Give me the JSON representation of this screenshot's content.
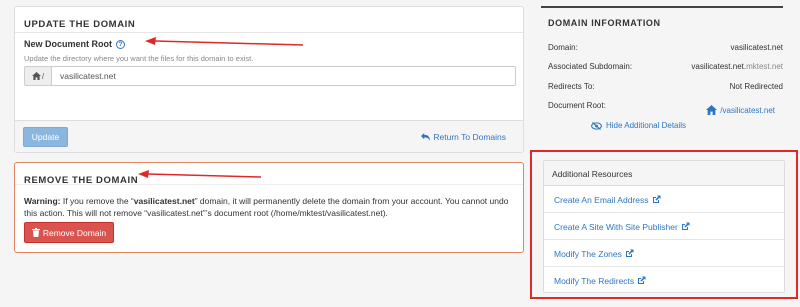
{
  "update_panel": {
    "title": "UPDATE THE DOMAIN",
    "field_label": "New Document Root",
    "field_hint": "Update the directory where you want the files for this domain to exist.",
    "input_addon": "/",
    "input_value": "vasilicatest.net",
    "update_button": "Update",
    "return_link": "Return To Domains"
  },
  "remove_panel": {
    "title": "REMOVE THE DOMAIN",
    "warning_label": "Warning:",
    "warning_pre": " If you remove the “",
    "warning_domain": "vasilicatest.net",
    "warning_post": "” domain, it will permanently delete the domain from your account. You cannot undo this action. This will not remove “vasilicatest.net”’s document root (/home/mktest/vasilicatest.net).",
    "remove_button": "Remove Domain"
  },
  "domain_info": {
    "title": "DOMAIN INFORMATION",
    "rows": [
      {
        "label": "Domain:",
        "value": "vasilicatest.net"
      },
      {
        "label": "Associated Subdomain:",
        "value": "vasilicatest.net.",
        "value_muted": "mktest.net"
      },
      {
        "label": "Redirects To:",
        "value": "Not Redirected"
      },
      {
        "label": "Document Root:",
        "value": "/vasilicatest.net"
      }
    ],
    "hide_details": "Hide Additional Details"
  },
  "resources": {
    "title": "Additional Resources",
    "items": [
      "Create An Email Address",
      "Create A Site With Site Publisher",
      "Modify The Zones",
      "Modify The Redirects"
    ]
  },
  "colors": {
    "link": "#2f76c1",
    "danger": "#d9534f",
    "annotation": "#e02828"
  }
}
